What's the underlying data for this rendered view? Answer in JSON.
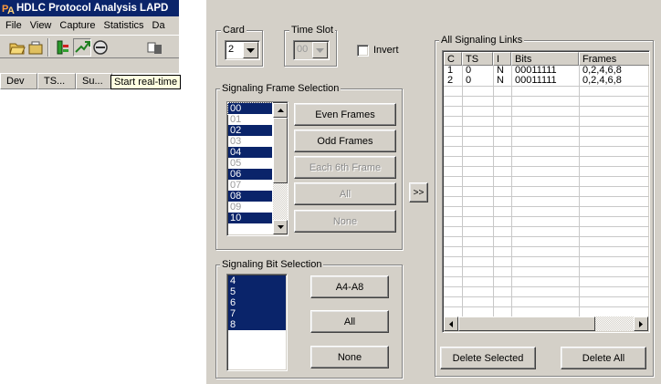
{
  "main_window": {
    "title": "HDLC Protocol Analysis LAPD",
    "menu": [
      "File",
      "View",
      "Capture",
      "Statistics",
      "Da"
    ],
    "columns": [
      "Dev",
      "TS...",
      "Su..."
    ],
    "tooltip": "Start real-time"
  },
  "dialog": {
    "card_label": "Card",
    "card_value": "2",
    "timeslot_label": "Time Slot",
    "timeslot_value": "00",
    "invert_label": "Invert",
    "frame_group_label": "Signaling Frame Selection",
    "frames": [
      {
        "label": "00",
        "selected": true
      },
      {
        "label": "01",
        "selected": false
      },
      {
        "label": "02",
        "selected": true
      },
      {
        "label": "03",
        "selected": false
      },
      {
        "label": "04",
        "selected": true
      },
      {
        "label": "05",
        "selected": false
      },
      {
        "label": "06",
        "selected": true
      },
      {
        "label": "07",
        "selected": false
      },
      {
        "label": "08",
        "selected": true
      },
      {
        "label": "09",
        "selected": false
      },
      {
        "label": "10",
        "selected": true
      }
    ],
    "frame_buttons": {
      "even": "Even Frames",
      "odd": "Odd Frames",
      "sixth": "Each 6th Frame",
      "all": "All",
      "none": "None"
    },
    "bit_group_label": "Signaling Bit Selection",
    "bits": [
      "4",
      "5",
      "6",
      "7",
      "8"
    ],
    "bit_buttons": {
      "a4a8": "A4-A8",
      "all": "All",
      "none": "None"
    },
    "transfer_button": ">>",
    "links_group_label": "All Signaling Links",
    "links_columns": [
      "C",
      "TS",
      "I",
      "Bits",
      "Frames"
    ],
    "links_rows": [
      [
        "1",
        "0",
        "N",
        "00011111",
        "0,2,4,6,8"
      ],
      [
        "2",
        "0",
        "N",
        "00011111",
        "0,2,4,6,8"
      ]
    ],
    "delete_selected": "Delete Selected",
    "delete_all": "Delete All"
  },
  "colors": {
    "face": "#d4d0c8",
    "selection": "#0a246a",
    "title_bar": "#0a246a",
    "tooltip_bg": "#ffffe1"
  }
}
